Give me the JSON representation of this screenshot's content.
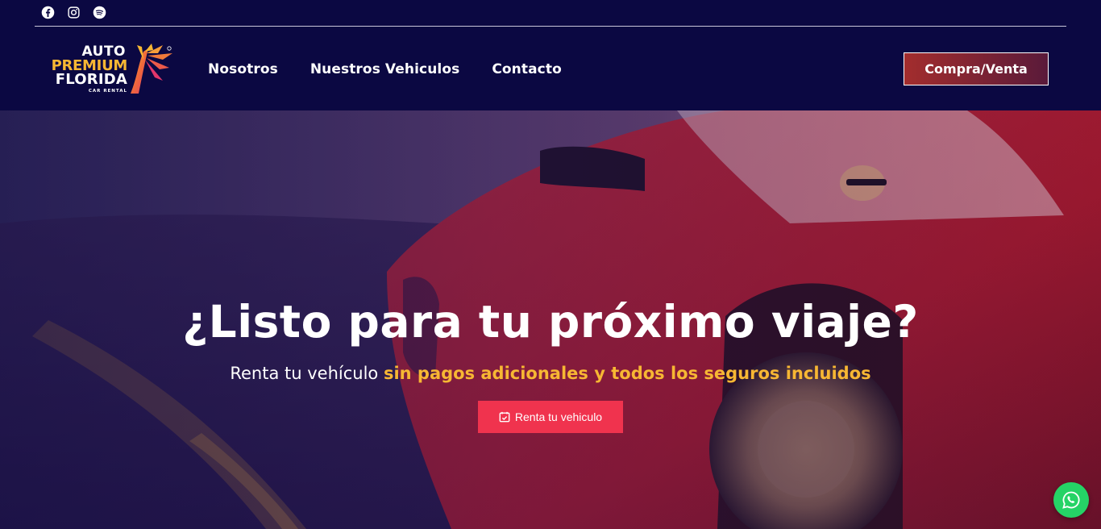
{
  "social": [
    {
      "icon": "facebook-icon"
    },
    {
      "icon": "instagram-icon"
    },
    {
      "icon": "spotify-icon"
    }
  ],
  "logo": {
    "line1": "AUTO",
    "line2": "PREMIUM",
    "line3": "FLORIDA",
    "tagline": "CAR RENTAL"
  },
  "nav": {
    "items": [
      "Nosotros",
      "Nuestros Vehiculos",
      "Contacto"
    ]
  },
  "cta": {
    "label": "Compra/Venta"
  },
  "hero": {
    "title": "¿Listo para tu próximo viaje?",
    "subtitle_plain": "Renta tu vehículo ",
    "subtitle_highlight": "sin pagos adicionales y todos los seguros incluidos",
    "button_label": "Renta tu vehiculo",
    "button_icon": "calendar-check-icon"
  },
  "colors": {
    "header_bg": "#0b0842",
    "accent_gold": "#f7b733",
    "button_red": "#f0334e",
    "whatsapp_green": "#25d366"
  },
  "floating": {
    "icon": "whatsapp-icon"
  }
}
